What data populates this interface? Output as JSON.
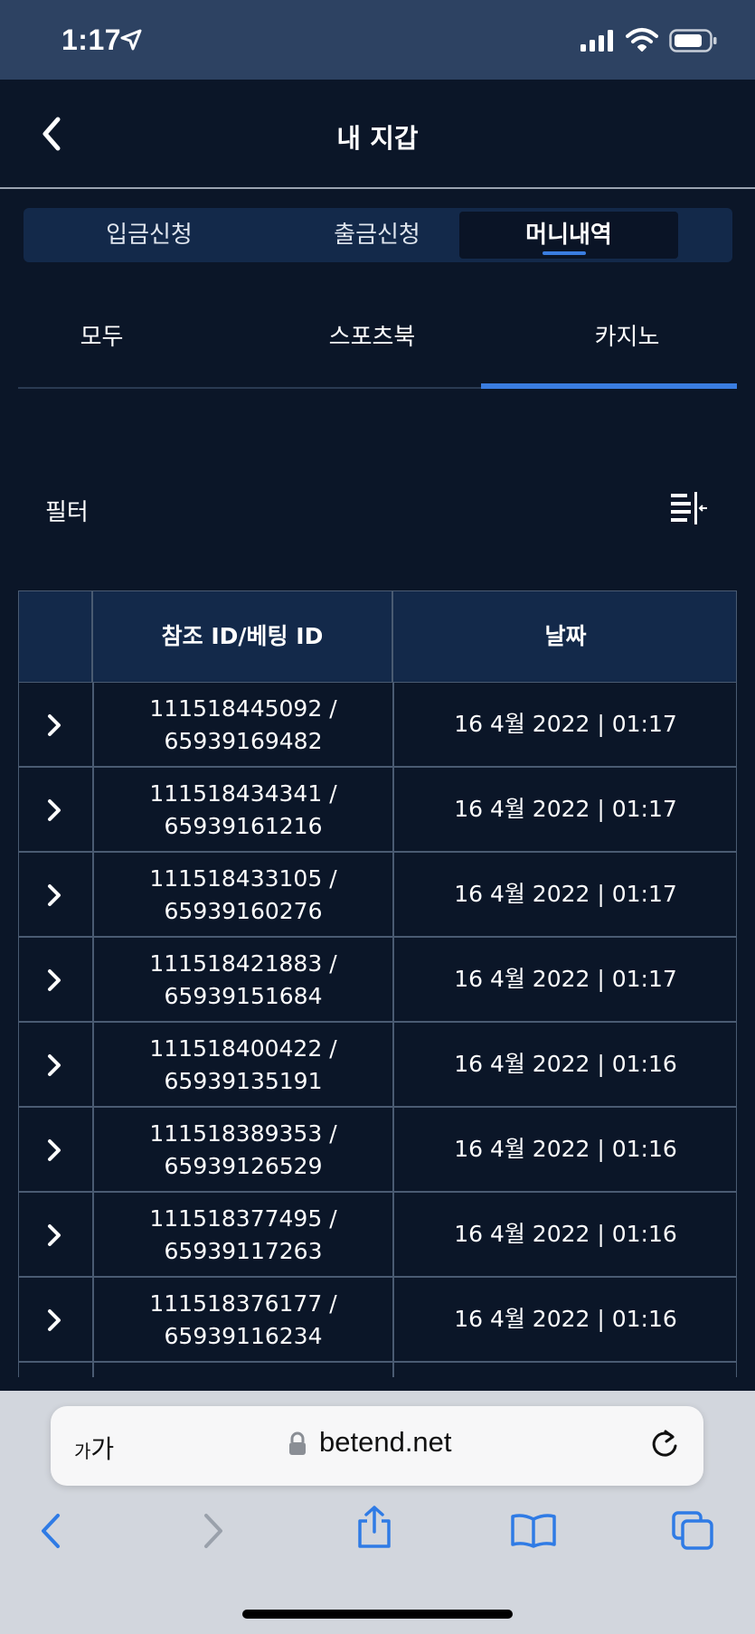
{
  "status_bar": {
    "time": "1:17"
  },
  "header": {
    "title": "내 지갑"
  },
  "main_tabs": [
    {
      "label": "입금신청",
      "active": false
    },
    {
      "label": "출금신청",
      "active": false
    },
    {
      "label": "머니내역",
      "active": true
    }
  ],
  "sub_tabs": [
    {
      "label": "모두",
      "active": false
    },
    {
      "label": "스포츠북",
      "active": false
    },
    {
      "label": "카지노",
      "active": true
    }
  ],
  "filter": {
    "label": "필터"
  },
  "table": {
    "columns": [
      "참조 ID/베팅 ID",
      "날짜"
    ],
    "rows": [
      {
        "ref_id": "111518445092 /",
        "bet_id": "65939169482",
        "date": "16 4월 2022 | 01:17"
      },
      {
        "ref_id": "111518434341 /",
        "bet_id": "65939161216",
        "date": "16 4월 2022 | 01:17"
      },
      {
        "ref_id": "111518433105 /",
        "bet_id": "65939160276",
        "date": "16 4월 2022 | 01:17"
      },
      {
        "ref_id": "111518421883 /",
        "bet_id": "65939151684",
        "date": "16 4월 2022 | 01:17"
      },
      {
        "ref_id": "111518400422 /",
        "bet_id": "65939135191",
        "date": "16 4월 2022 | 01:16"
      },
      {
        "ref_id": "111518389353 /",
        "bet_id": "65939126529",
        "date": "16 4월 2022 | 01:16"
      },
      {
        "ref_id": "111518377495 /",
        "bet_id": "65939117263",
        "date": "16 4월 2022 | 01:16"
      },
      {
        "ref_id": "111518376177 /",
        "bet_id": "65939116234",
        "date": "16 4월 2022 | 01:16"
      }
    ]
  },
  "browser": {
    "aa_small": "가",
    "aa_large": "가",
    "url": "betend.net"
  },
  "colors": {
    "background": "#0b1628",
    "accent": "#3a7de0",
    "header_bg": "#13294a"
  },
  "icons": [
    "location-arrow-icon",
    "signal-icon",
    "wifi-icon",
    "battery-icon",
    "back-chevron-icon",
    "filter-icon",
    "chevron-right-icon",
    "lock-icon",
    "reload-icon",
    "share-icon",
    "bookmarks-icon",
    "tabs-icon"
  ]
}
